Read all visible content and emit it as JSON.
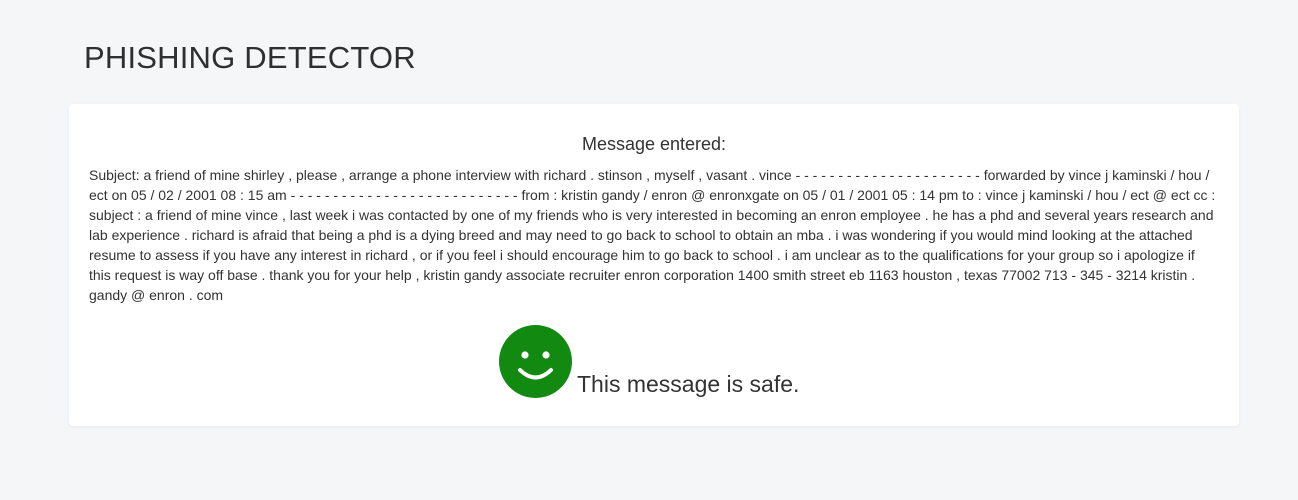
{
  "header": {
    "title": "PHISHING DETECTOR"
  },
  "result": {
    "heading": "Message entered:",
    "message": "Subject: a friend of mine shirley , please , arrange a phone interview with richard . stinson , myself , vasant . vince - - - - - - - - - - - - - - - - - - - - - - forwarded by vince j kaminski / hou / ect on 05 / 02 / 2001 08 : 15 am - - - - - - - - - - - - - - - - - - - - - - - - - - - from : kristin gandy / enron @ enronxgate on 05 / 01 / 2001 05 : 14 pm to : vince j kaminski / hou / ect @ ect cc : subject : a friend of mine vince , last week i was contacted by one of my friends who is very interested in becoming an enron employee . he has a phd and several years research and lab experience . richard is afraid that being a phd is a dying breed and may need to go back to school to obtain an mba . i was wondering if you would mind looking at the attached resume to assess if you have any interest in richard , or if you feel i should encourage him to go back to school . i am unclear as to the qualifications for your group so i apologize if this request is way off base . thank you for your help , kristin gandy associate recruiter enron corporation 1400 smith street eb 1163 houston , texas 77002 713 - 345 - 3214 kristin . gandy @ enron . com",
    "verdict": "This message is safe.",
    "verdict_icon": "smiley-face-icon",
    "verdict_color": "#128a12"
  }
}
